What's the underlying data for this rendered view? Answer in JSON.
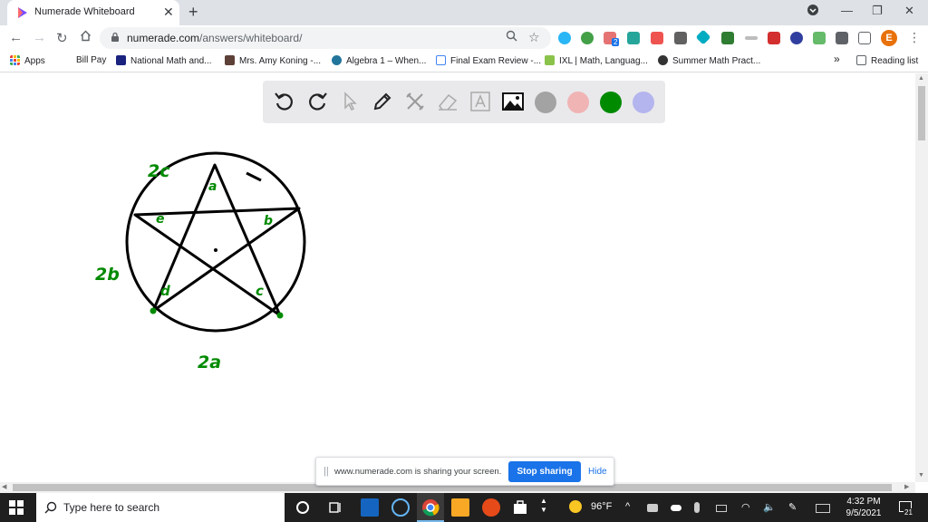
{
  "browser": {
    "tab_title": "Numerade Whiteboard",
    "url_host": "numerade.com",
    "url_path": "/answers/whiteboard/",
    "profile_initial": "E",
    "extension_badge": "2"
  },
  "bookmarks": {
    "items": [
      {
        "label": "Apps",
        "icon": "apps-grid-icon",
        "color": "#ea4335"
      },
      {
        "label": "Bill Pay",
        "icon": "none",
        "color": ""
      },
      {
        "label": "National Math and...",
        "icon": "crossed-x-icon",
        "color": "#1a237e"
      },
      {
        "label": "Mrs. Amy Koning -...",
        "icon": "photo-icon",
        "color": "#5d4037"
      },
      {
        "label": "Algebra 1 – When...",
        "icon": "wordpress-icon",
        "color": "#21759b"
      },
      {
        "label": "Final Exam Review -...",
        "icon": "doc-icon",
        "color": "#4285f4"
      },
      {
        "label": "IXL | Math, Languag...",
        "icon": "ixl-icon",
        "color": "#8bc34a"
      },
      {
        "label": "Summer Math Pract...",
        "icon": "circle-logo-icon",
        "color": "#333333"
      }
    ],
    "overflow": "»",
    "reading_list": "Reading list"
  },
  "whiteboard": {
    "tools": [
      "undo-icon",
      "redo-icon",
      "pointer-icon",
      "pen-icon",
      "tools-icon",
      "eraser-icon",
      "text-icon",
      "image-icon"
    ],
    "colors": [
      "#a3a3a3",
      "#f0b4b4",
      "#008a00",
      "#b4b4ee"
    ],
    "drawing_labels": {
      "top_left": "2c",
      "left": "2b",
      "bottom": "2a",
      "angle_a": "a",
      "angle_b": "b",
      "angle_c": "c",
      "angle_d": "d",
      "angle_e": "e"
    }
  },
  "share_banner": {
    "message": "www.numerade.com is sharing your screen.",
    "stop_label": "Stop sharing",
    "hide_label": "Hide"
  },
  "taskbar": {
    "search_placeholder": "Type here to search",
    "weather": "96°F",
    "time": "4:32 PM",
    "date": "9/5/2021",
    "notifications": "21"
  }
}
